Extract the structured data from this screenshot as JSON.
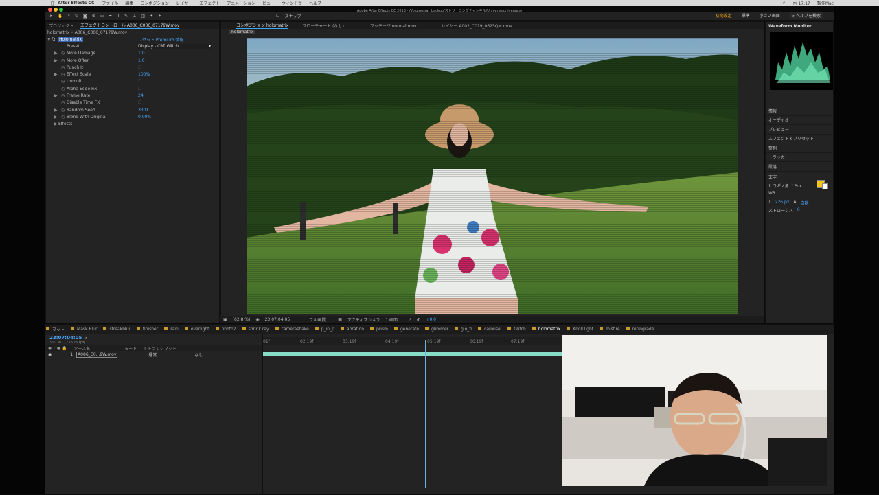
{
  "menubar": {
    "app_name": "After Effects CC",
    "items": [
      "ファイル",
      "編集",
      "コンポジション",
      "レイヤー",
      "エフェクト",
      "アニメーション",
      "ビュー",
      "ウィンドウ",
      "ヘルプ"
    ],
    "clock": "水 17:17",
    "user": "製作Mac"
  },
  "window": {
    "title": "Adobe After Effects CC 2015 - /Volumes/at_backup/ストリーミングチャンネル/Universe/universe.aep *"
  },
  "toolbar": {
    "snap_label": "スナップ",
    "workspaces": [
      "初期設定",
      "標準",
      "小さい画面"
    ],
    "active_workspace": "初期設定",
    "search_placeholder": "ヘルプを検索"
  },
  "left_panel": {
    "tabs": [
      "プロジェクト",
      "エフェクトコントロール A006_C006_07179W.mov"
    ],
    "breadcrumb": "holomatrix • A006_C006_07179W.mov",
    "effect_name": "Holomatrix",
    "effect_links": "リセット Premium 情報...",
    "preset_label": "Preset",
    "preset_value": "Display - CRT Glitch",
    "props": [
      {
        "name": "More Damage",
        "value": "1.0"
      },
      {
        "name": "More Often",
        "value": "1.0"
      },
      {
        "name": "Punch It",
        "value": ""
      },
      {
        "name": "Effect Scale",
        "value": "100%"
      },
      {
        "name": "Unmult",
        "value": ""
      },
      {
        "name": "Alpha Edge Fix",
        "value": ""
      },
      {
        "name": "Frame Rate",
        "value": "24"
      },
      {
        "name": "Disable Time FX",
        "value": ""
      },
      {
        "name": "Random Seed",
        "value": "3301"
      },
      {
        "name": "Blend With Original",
        "value": "0.00%"
      },
      {
        "name": "Effects",
        "value": ""
      }
    ]
  },
  "comp_panel": {
    "tabs": [
      "コンポジション holomatrix",
      "フローチャート (なし)",
      "フッテージ normal.mov",
      "レイヤー A002_C019_0625QM.mov"
    ],
    "comp_chip": "holomatrix",
    "zoom": "(62.8 %)",
    "timecode": "23:07:04:05",
    "quality": "フル画質",
    "camera": "アクティブカメラ",
    "views": "1 画面",
    "exposure": "+0.0"
  },
  "right_panel": {
    "waveform_title": "Waveform Monitor",
    "panels": [
      "情報",
      "オーディオ",
      "プレビュー",
      "エフェクト＆プリセット",
      "整列",
      "トラッカー",
      "段落"
    ],
    "char_title": "文字",
    "font_name": "ヒラギノ角ゴ Pro",
    "font_weight": "W3",
    "font_size": "226 px",
    "leading": "自動",
    "stroke_label": "ストロークス",
    "tracking": "0",
    "colors": {
      "fill": "#f5c518",
      "stroke": "#ffffff"
    }
  },
  "timeline": {
    "tabs": [
      "マット",
      "Mask Blur",
      "streakblur",
      "finisher",
      "rain",
      "overlight",
      "photo2",
      "shrink ray",
      "camerashake",
      "p_in_p",
      "abration",
      "prism",
      "generate",
      "glimmer",
      "glo_fi",
      "carousel",
      "Glitch",
      "holomatrix",
      "Knoll light",
      "misfire",
      "retrograde"
    ],
    "active_tab": "holomatrix",
    "timecode": "23:07:04:05",
    "frame_info": "1997381 (23.976 fps)",
    "col_source": "ソース名",
    "col_mode": "モード",
    "col_trkmat": "T トラックマット",
    "layer_num": "1",
    "layer_name": "A006_C0...9W.mov",
    "layer_mode": "通常",
    "layer_parent": "なし",
    "ruler": [
      "01f",
      "02:19f",
      "03:19f",
      "04:19f",
      "05:19f",
      "06:19f",
      "07:19f"
    ]
  }
}
